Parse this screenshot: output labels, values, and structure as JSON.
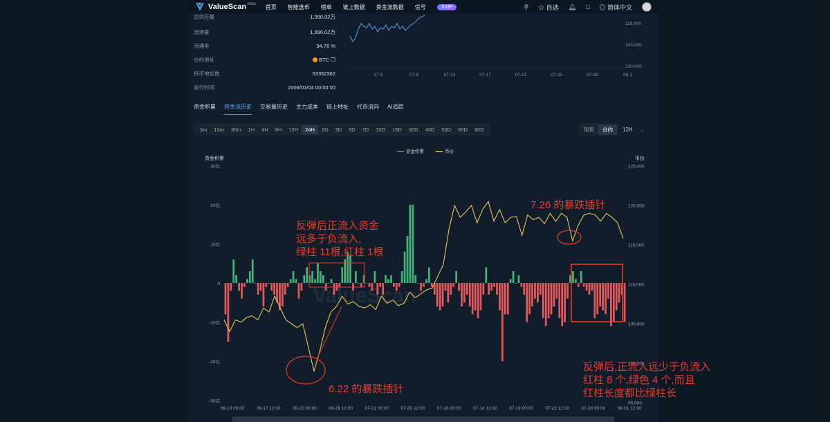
{
  "nav": {
    "brand": "ValueScan",
    "beta": "beta",
    "items": [
      "首页",
      "智能选币",
      "榜单",
      "链上数据",
      "资金流数据",
      "信号"
    ],
    "vip": "SVIP",
    "favorites": "自选",
    "language": "简体中文"
  },
  "info": [
    {
      "label": "总供应量",
      "value": "1,990.02万"
    },
    {
      "label": "流通量",
      "value": "1,990.02万"
    },
    {
      "label": "流通率",
      "value": "94.76 %"
    },
    {
      "label": "合约地址",
      "value": "BTC"
    },
    {
      "label": "持币地址数",
      "value": "53352362"
    },
    {
      "label": "发行时间",
      "value": "2009/01/04 00:00:00"
    }
  ],
  "mini_chart": {
    "x_ticks": [
      "07-5",
      "07-9",
      "07-13",
      "07-17",
      "07-21",
      "07-25",
      "07-29",
      "08-1"
    ],
    "y_ticks": [
      "110,000",
      "105,000",
      "100,000"
    ]
  },
  "tabs": [
    "资金积累",
    "资金流历史",
    "交易量历史",
    "主力成本",
    "链上地址",
    "代币流向",
    "AI追踪"
  ],
  "active_tab": 1,
  "intervals": [
    "5m",
    "15m",
    "30m",
    "1H",
    "4H",
    "8H",
    "12H",
    "24H",
    "2D",
    "3D",
    "5D",
    "7D",
    "10D",
    "15D",
    "30D",
    "40D",
    "50D",
    "60D",
    "90D"
  ],
  "active_interval": "24H",
  "market_types": [
    "现货",
    "合约"
  ],
  "active_market": "合约",
  "resolution": "12H",
  "chart_data": {
    "type": "bar",
    "title": "",
    "legend": [
      "资金积累",
      "币价"
    ],
    "legend_position": "top-center",
    "ylabel_left": "资金积累",
    "ylabel_right": "币价",
    "left_ticks": [
      "30亿",
      "20亿",
      "10亿",
      "0",
      "-10亿",
      "-20亿",
      "-30亿"
    ],
    "right_ticks": [
      "125,000",
      "120,000",
      "115,000",
      "110,000",
      "105,000",
      "100,000",
      "95,000"
    ],
    "ylim_left": [
      -30,
      30
    ],
    "ylim_right": [
      95000,
      125000
    ],
    "x_ticks": [
      "06-13 00:00",
      "06-17 12:00",
      "06-22 00:00",
      "06-26 12:00",
      "07-01 00:00",
      "07-05 12:00",
      "07-10 00:00",
      "07-14 12:00",
      "07-19 00:00",
      "07-23 12:00",
      "07-28 00:00",
      "08-01 12:00"
    ],
    "grid": true,
    "watermark": "ValueScan",
    "series": [
      {
        "name": "资金积累",
        "unit": "亿",
        "values": [
          -8,
          -15,
          -2,
          6,
          2,
          -2,
          -4,
          -1,
          1,
          3,
          6,
          0,
          -3,
          -2,
          -6,
          -1,
          0,
          -2,
          -3,
          -5,
          -7,
          -6,
          -3,
          -1,
          1,
          3,
          1,
          -4,
          -2,
          2,
          4,
          2,
          3,
          1,
          5,
          3,
          2,
          -2,
          0,
          1,
          -3,
          -2,
          -1,
          4,
          6,
          8,
          7,
          -2,
          3,
          0,
          -1,
          2,
          0,
          -1,
          -2,
          3,
          -3,
          -1,
          -3,
          2,
          1,
          2,
          -1,
          -2,
          -1,
          3,
          8,
          12,
          20,
          20,
          2,
          0,
          -2,
          -1,
          1,
          4,
          -1,
          -3,
          -6,
          -7,
          -6,
          -2,
          -5,
          -3,
          -1,
          3,
          -2,
          -6,
          -5,
          -3,
          -6,
          -8,
          -7,
          -9,
          -7,
          -3,
          4,
          -3,
          -2,
          -1,
          -3,
          -7,
          -20,
          -8,
          -8,
          1,
          3,
          0,
          2,
          -1,
          -3,
          -10,
          -8,
          -6,
          -4,
          -5,
          -3,
          -9,
          -11,
          -9,
          -8,
          -6,
          -4,
          -9,
          -11,
          -10,
          -4,
          2,
          3,
          1,
          -1,
          3,
          -1,
          -2,
          -3,
          -2,
          -9,
          -8,
          -6,
          -7,
          -8,
          -4,
          -11,
          -10,
          -7,
          -5,
          -3,
          -10
        ]
      },
      {
        "name": "币价",
        "unit": "USD",
        "values": [
          105500,
          104000,
          105500,
          105200,
          105800,
          106000,
          105500,
          107000,
          106500,
          108500,
          107000,
          105500,
          105000,
          104500,
          105000,
          102000,
          99000,
          101500,
          104500,
          106500,
          107200,
          108500,
          107500,
          107800,
          107200,
          107000,
          107400,
          106800,
          108500,
          107600,
          108000,
          107300,
          107600,
          109000,
          108300,
          108800,
          109300,
          109500,
          111000,
          112500,
          117000,
          120000,
          118500,
          119200,
          120000,
          117800,
          119500,
          120500,
          118000,
          119500,
          117800,
          118500,
          118600,
          116200,
          118800,
          118200,
          118500,
          117700,
          119000,
          118000,
          119000,
          118500,
          115500,
          117500,
          118800,
          119000,
          118800,
          118000,
          119000,
          118500,
          117800,
          115800
        ]
      }
    ],
    "annotations": [
      {
        "lines": [
          "反弹后正流入资金",
          "远多于负流入,",
          "绿柱 11根,红柱 1根"
        ]
      },
      {
        "lines": [
          "7.26 的暴跌插针"
        ]
      },
      {
        "lines": [
          "6.22 的暴跌插针"
        ]
      },
      {
        "lines": [
          "反弹后,正流入远少于负流入",
          "红柱 8 个,绿色 4 个,而且",
          "红柱长度都比绿柱长"
        ]
      }
    ]
  },
  "colors": {
    "positive": "#44b27a",
    "negative": "#e3595c",
    "price": "#e8c65b",
    "annotation": "#ea3b2c",
    "accent": "#3d8bff"
  }
}
